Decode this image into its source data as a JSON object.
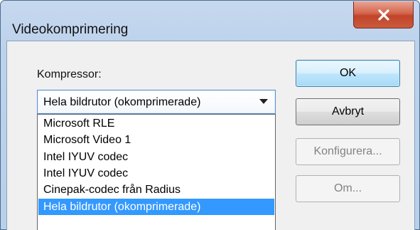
{
  "window": {
    "title": "Videokomprimering"
  },
  "close_icon": "close-icon",
  "compressor": {
    "label": "Kompressor:",
    "selected_value": "Hela bildrutor (okomprimerade)",
    "options": [
      {
        "label": "Microsoft RLE"
      },
      {
        "label": "Microsoft Video 1"
      },
      {
        "label": "Intel IYUV codec"
      },
      {
        "label": "Intel IYUV codec"
      },
      {
        "label": "Cinepak-codec från Radius"
      },
      {
        "label": "Hela bildrutor (okomprimerade)",
        "selected": true
      }
    ]
  },
  "buttons": {
    "ok": "OK",
    "cancel": "Avbryt",
    "configure": "Konfigurera...",
    "about": "Om..."
  },
  "colors": {
    "selection": "#3399ff",
    "close_button": "#c2432a",
    "title_gradient": "#bcd2ec"
  }
}
